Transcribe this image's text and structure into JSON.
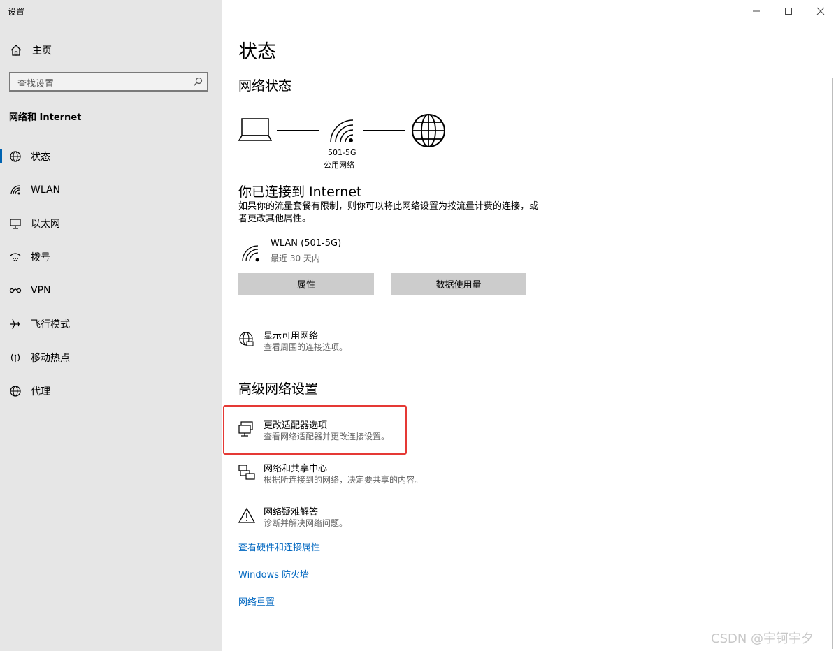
{
  "window": {
    "title": "设置"
  },
  "sidebar": {
    "home_label": "主页",
    "search_placeholder": "查找设置",
    "section_label": "网络和 Internet",
    "items": [
      {
        "label": "状态",
        "icon": "globe-status-icon",
        "active": true
      },
      {
        "label": "WLAN",
        "icon": "wifi-icon",
        "active": false
      },
      {
        "label": "以太网",
        "icon": "ethernet-icon",
        "active": false
      },
      {
        "label": "拨号",
        "icon": "dialup-icon",
        "active": false
      },
      {
        "label": "VPN",
        "icon": "vpn-icon",
        "active": false
      },
      {
        "label": "飞行模式",
        "icon": "airplane-icon",
        "active": false
      },
      {
        "label": "移动热点",
        "icon": "hotspot-icon",
        "active": false
      },
      {
        "label": "代理",
        "icon": "globe-icon",
        "active": false
      }
    ]
  },
  "main": {
    "title": "状态",
    "network_status_heading": "网络状态",
    "network_name": "501-5G",
    "network_type": "公用网络",
    "connected_heading": "你已连接到 Internet",
    "connected_desc": "如果你的流量套餐有限制，则你可以将此网络设置为按流量计费的连接，或者更改其他属性。",
    "connection": {
      "name": "WLAN (501-5G)",
      "detail": "最近 30 天内"
    },
    "buttons": {
      "properties": "属性",
      "data_usage": "数据使用量"
    },
    "show_networks": {
      "title": "显示可用网络",
      "desc": "查看周围的连接选项。"
    },
    "advanced_heading": "高级网络设置",
    "advanced_items": [
      {
        "title": "更改适配器选项",
        "desc": "查看网络适配器并更改连接设置。"
      },
      {
        "title": "网络和共享中心",
        "desc": "根据所连接到的网络，决定要共享的内容。"
      },
      {
        "title": "网络疑难解答",
        "desc": "诊断并解决网络问题。"
      }
    ],
    "links": [
      "查看硬件和连接属性",
      "Windows 防火墙",
      "网络重置"
    ]
  },
  "colors": {
    "accent": "#0063b1",
    "link": "#0067c0",
    "highlight_border": "#e53935",
    "sidebar_bg": "#e6e6e6"
  },
  "watermark": "CSDN @宇钶宇夕"
}
